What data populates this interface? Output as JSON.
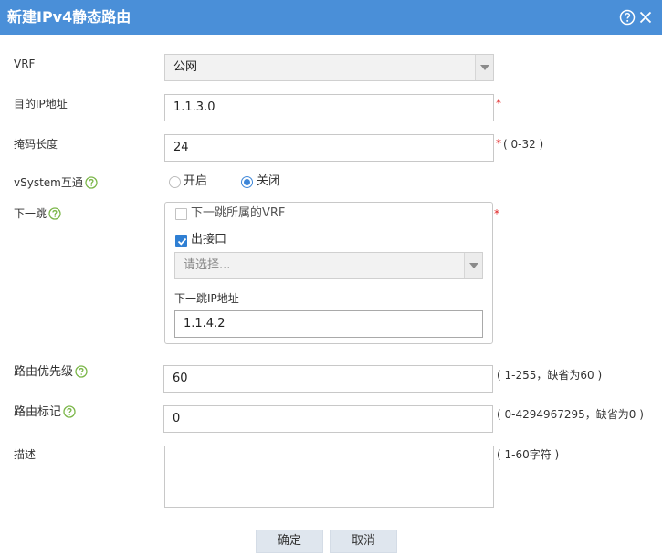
{
  "dialog": {
    "title": "新建IPv4静态路由"
  },
  "form": {
    "vrf": {
      "label": "VRF",
      "value": "公网"
    },
    "dest_ip": {
      "label": "目的IP地址",
      "value": "1.1.3.0",
      "required": "*"
    },
    "mask": {
      "label": "掩码长度",
      "value": "24",
      "required": "*",
      "hint": "( 0-32 )"
    },
    "vsystem": {
      "label": "vSystem互通",
      "options": [
        "开启",
        "关闭"
      ],
      "selected": "关闭"
    },
    "nexthop": {
      "label": "下一跳",
      "required": "*",
      "vrf_checkbox": {
        "label": "下一跳所属的VRF",
        "checked": false
      },
      "outif_checkbox": {
        "label": "出接口",
        "checked": true
      },
      "outif_select": {
        "placeholder": "请选择..."
      },
      "nexthop_ip": {
        "label": "下一跳IP地址",
        "value": "1.1.4.2"
      }
    },
    "priority": {
      "label": "路由优先级",
      "value": "60",
      "hint": "( 1-255，缺省为60 )"
    },
    "tag": {
      "label": "路由标记",
      "value": "0",
      "hint": "( 0-4294967295，缺省为0 )"
    },
    "description": {
      "label": "描述",
      "value": "",
      "hint": "( 1-60字符 )"
    }
  },
  "buttons": {
    "ok": "确定",
    "cancel": "取消"
  },
  "colors": {
    "titlebar": "#4a8fd8",
    "accent": "#2f7fd3",
    "help_icon": "#7ab648",
    "required": "#e02020"
  }
}
